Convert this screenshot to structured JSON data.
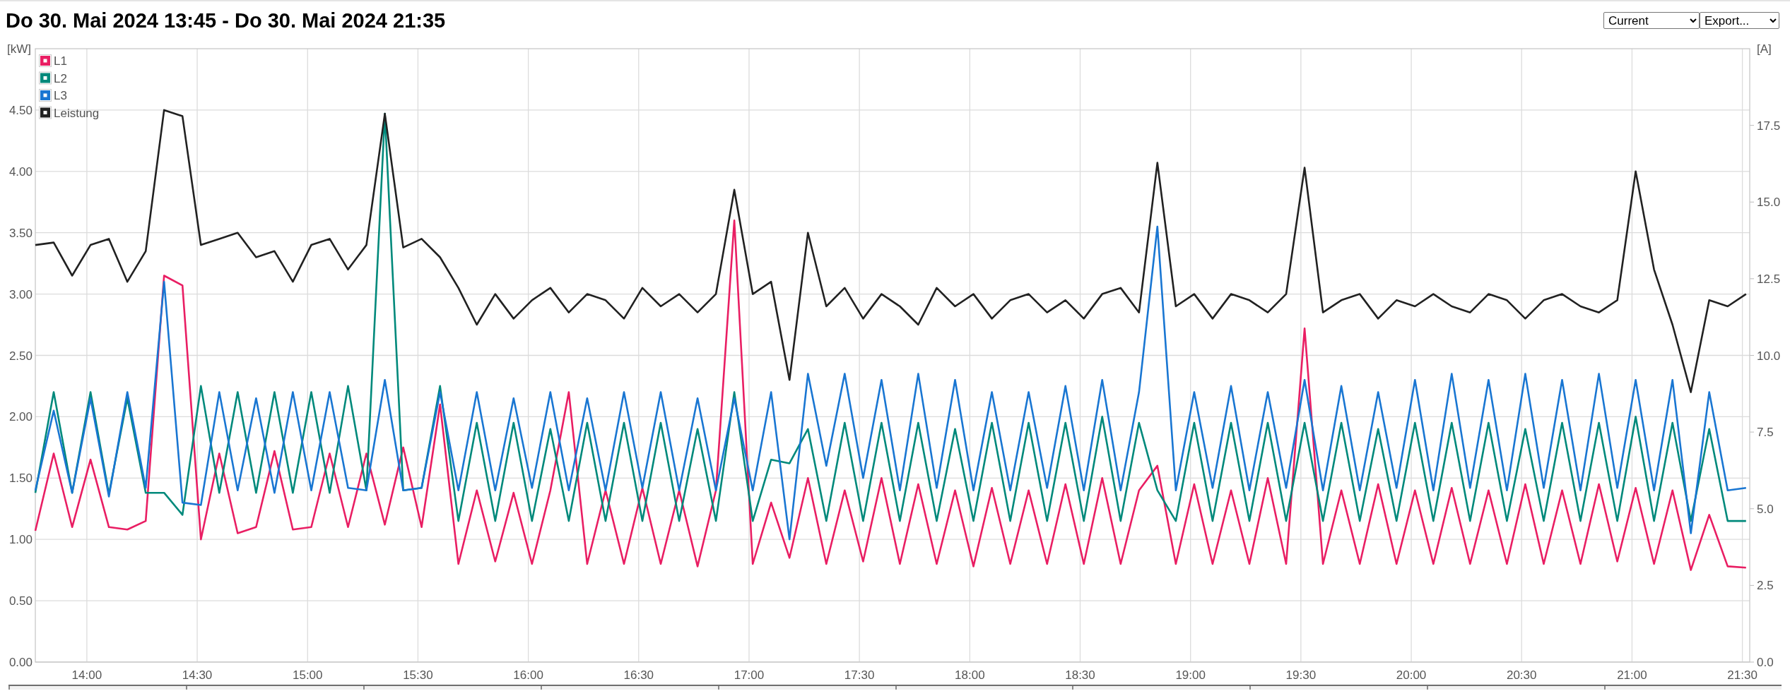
{
  "header": {
    "title": "Do 30. Mai 2024 13:45 - Do 30. Mai 2024 21:35",
    "selects": [
      {
        "value": "Current"
      },
      {
        "value": "Export..."
      }
    ]
  },
  "chart": {
    "chart_data": {
      "type": "line",
      "grid": true,
      "legend": true,
      "ylabel": "[kW]",
      "y2label": "[A]",
      "xlim": [
        826,
        1292
      ],
      "ylim": [
        0,
        5.0
      ],
      "y2lim": [
        0,
        20
      ],
      "xticks": [
        {
          "value": 840,
          "label": "14:00"
        },
        {
          "value": 870,
          "label": "14:30"
        },
        {
          "value": 900,
          "label": "15:00"
        },
        {
          "value": 930,
          "label": "15:30"
        },
        {
          "value": 960,
          "label": "16:00"
        },
        {
          "value": 990,
          "label": "16:30"
        },
        {
          "value": 1020,
          "label": "17:00"
        },
        {
          "value": 1050,
          "label": "17:30"
        },
        {
          "value": 1080,
          "label": "18:00"
        },
        {
          "value": 1110,
          "label": "18:30"
        },
        {
          "value": 1140,
          "label": "19:00"
        },
        {
          "value": 1170,
          "label": "19:30"
        },
        {
          "value": 1200,
          "label": "20:00"
        },
        {
          "value": 1230,
          "label": "20:30"
        },
        {
          "value": 1260,
          "label": "21:00"
        },
        {
          "value": 1290,
          "label": "21:30"
        }
      ],
      "yticks": [
        {
          "value": 0,
          "label": "0.00"
        },
        {
          "value": 0.5,
          "label": "0.50"
        },
        {
          "value": 1,
          "label": "1.00"
        },
        {
          "value": 1.5,
          "label": "1.50"
        },
        {
          "value": 2,
          "label": "2.00"
        },
        {
          "value": 2.5,
          "label": "2.50"
        },
        {
          "value": 3,
          "label": "3.00"
        },
        {
          "value": 3.5,
          "label": "3.50"
        },
        {
          "value": 4,
          "label": "4.00"
        },
        {
          "value": 4.5,
          "label": "4.50"
        }
      ],
      "y2ticks": [
        {
          "value": 0,
          "label": "0.0"
        },
        {
          "value": 2.5,
          "label": "2.5"
        },
        {
          "value": 5,
          "label": "5.0"
        },
        {
          "value": 7.5,
          "label": "7.5"
        },
        {
          "value": 10,
          "label": "10.0"
        },
        {
          "value": 12.5,
          "label": "12.5"
        },
        {
          "value": 15,
          "label": "15.0"
        },
        {
          "value": 17.5,
          "label": "17.5"
        }
      ],
      "x": [
        826,
        831,
        836,
        841,
        846,
        851,
        856,
        861,
        866,
        871,
        876,
        881,
        886,
        891,
        896,
        901,
        906,
        911,
        916,
        921,
        926,
        931,
        936,
        941,
        946,
        951,
        956,
        961,
        966,
        971,
        976,
        981,
        986,
        991,
        996,
        1001,
        1006,
        1011,
        1016,
        1021,
        1026,
        1031,
        1036,
        1041,
        1046,
        1051,
        1056,
        1061,
        1066,
        1071,
        1076,
        1081,
        1086,
        1091,
        1096,
        1101,
        1106,
        1111,
        1116,
        1121,
        1126,
        1131,
        1136,
        1141,
        1146,
        1151,
        1156,
        1161,
        1166,
        1171,
        1176,
        1181,
        1186,
        1191,
        1196,
        1201,
        1206,
        1211,
        1216,
        1221,
        1226,
        1231,
        1236,
        1241,
        1246,
        1251,
        1256,
        1261,
        1266,
        1271,
        1276,
        1281,
        1286,
        1291
      ],
      "series": [
        {
          "name": "L1",
          "color": "#e91e63",
          "values": [
            1.07,
            1.7,
            1.1,
            1.65,
            1.1,
            1.08,
            1.15,
            3.15,
            3.07,
            1.0,
            1.7,
            1.05,
            1.1,
            1.72,
            1.08,
            1.1,
            1.7,
            1.1,
            1.7,
            1.12,
            1.75,
            1.1,
            2.1,
            0.8,
            1.4,
            0.82,
            1.38,
            0.8,
            1.4,
            2.2,
            0.8,
            1.4,
            0.8,
            1.42,
            0.8,
            1.4,
            0.78,
            1.4,
            3.6,
            0.8,
            1.3,
            0.85,
            1.5,
            0.8,
            1.4,
            0.82,
            1.5,
            0.8,
            1.45,
            0.8,
            1.4,
            0.78,
            1.42,
            0.8,
            1.4,
            0.8,
            1.45,
            0.8,
            1.5,
            0.8,
            1.4,
            1.6,
            0.8,
            1.45,
            0.8,
            1.4,
            0.8,
            1.5,
            0.8,
            2.72,
            0.8,
            1.4,
            0.8,
            1.45,
            0.8,
            1.4,
            0.8,
            1.42,
            0.8,
            1.4,
            0.8,
            1.45,
            0.8,
            1.4,
            0.8,
            1.45,
            0.82,
            1.42,
            0.8,
            1.4,
            0.75,
            1.2,
            0.78,
            0.77
          ]
        },
        {
          "name": "L2",
          "color": "#00897b",
          "values": [
            1.38,
            2.2,
            1.38,
            2.2,
            1.37,
            2.15,
            1.38,
            1.38,
            1.2,
            2.25,
            1.38,
            2.2,
            1.38,
            2.2,
            1.38,
            2.2,
            1.38,
            2.25,
            1.4,
            4.47,
            1.4,
            1.42,
            2.25,
            1.15,
            1.95,
            1.15,
            1.95,
            1.15,
            1.9,
            1.15,
            1.95,
            1.15,
            1.95,
            1.15,
            1.95,
            1.15,
            1.9,
            1.15,
            2.2,
            1.15,
            1.65,
            1.62,
            1.9,
            1.15,
            1.95,
            1.15,
            1.95,
            1.15,
            1.95,
            1.15,
            1.9,
            1.15,
            1.95,
            1.15,
            1.95,
            1.15,
            1.95,
            1.15,
            2.0,
            1.15,
            1.95,
            1.4,
            1.15,
            1.95,
            1.15,
            1.95,
            1.15,
            1.95,
            1.15,
            1.95,
            1.15,
            1.95,
            1.15,
            1.9,
            1.15,
            1.95,
            1.15,
            1.95,
            1.15,
            1.95,
            1.15,
            1.9,
            1.15,
            1.95,
            1.15,
            1.95,
            1.15,
            2.0,
            1.15,
            1.95,
            1.15,
            1.9,
            1.15,
            1.15
          ]
        },
        {
          "name": "L3",
          "color": "#1976d2",
          "values": [
            1.4,
            2.05,
            1.38,
            2.15,
            1.35,
            2.2,
            1.42,
            3.1,
            1.3,
            1.28,
            2.2,
            1.4,
            2.15,
            1.38,
            2.2,
            1.4,
            2.2,
            1.42,
            1.4,
            2.3,
            1.4,
            1.42,
            2.2,
            1.4,
            2.2,
            1.4,
            2.15,
            1.42,
            2.2,
            1.4,
            2.15,
            1.4,
            2.2,
            1.42,
            2.2,
            1.4,
            2.15,
            1.4,
            2.15,
            1.4,
            2.2,
            1.0,
            2.35,
            1.6,
            2.35,
            1.5,
            2.3,
            1.4,
            2.35,
            1.42,
            2.3,
            1.4,
            2.2,
            1.4,
            2.2,
            1.42,
            2.25,
            1.4,
            2.3,
            1.4,
            2.2,
            3.55,
            1.4,
            2.2,
            1.42,
            2.25,
            1.4,
            2.2,
            1.42,
            2.3,
            1.4,
            2.25,
            1.4,
            2.2,
            1.42,
            2.3,
            1.4,
            2.35,
            1.42,
            2.3,
            1.4,
            2.35,
            1.42,
            2.3,
            1.4,
            2.35,
            1.42,
            2.3,
            1.4,
            2.3,
            1.05,
            2.2,
            1.4,
            1.42
          ]
        },
        {
          "name": "Leistung",
          "color": "#212121",
          "values": [
            3.4,
            3.42,
            3.15,
            3.4,
            3.45,
            3.1,
            3.35,
            4.5,
            4.45,
            3.4,
            3.45,
            3.5,
            3.3,
            3.35,
            3.1,
            3.4,
            3.45,
            3.2,
            3.4,
            4.47,
            3.38,
            3.45,
            3.3,
            3.05,
            2.75,
            3.0,
            2.8,
            2.95,
            3.05,
            2.85,
            3.0,
            2.95,
            2.8,
            3.05,
            2.9,
            3.0,
            2.85,
            3.0,
            3.85,
            3.0,
            3.1,
            2.3,
            3.5,
            2.9,
            3.05,
            2.8,
            3.0,
            2.9,
            2.75,
            3.05,
            2.9,
            3.0,
            2.8,
            2.95,
            3.0,
            2.85,
            2.95,
            2.8,
            3.0,
            3.05,
            2.85,
            4.07,
            2.9,
            3.0,
            2.8,
            3.0,
            2.95,
            2.85,
            3.0,
            4.03,
            2.85,
            2.95,
            3.0,
            2.8,
            2.95,
            2.9,
            3.0,
            2.9,
            2.85,
            3.0,
            2.95,
            2.8,
            2.95,
            3.0,
            2.9,
            2.85,
            2.95,
            4.0,
            3.2,
            2.75,
            2.2,
            2.95,
            2.9,
            3.0
          ]
        }
      ]
    }
  }
}
